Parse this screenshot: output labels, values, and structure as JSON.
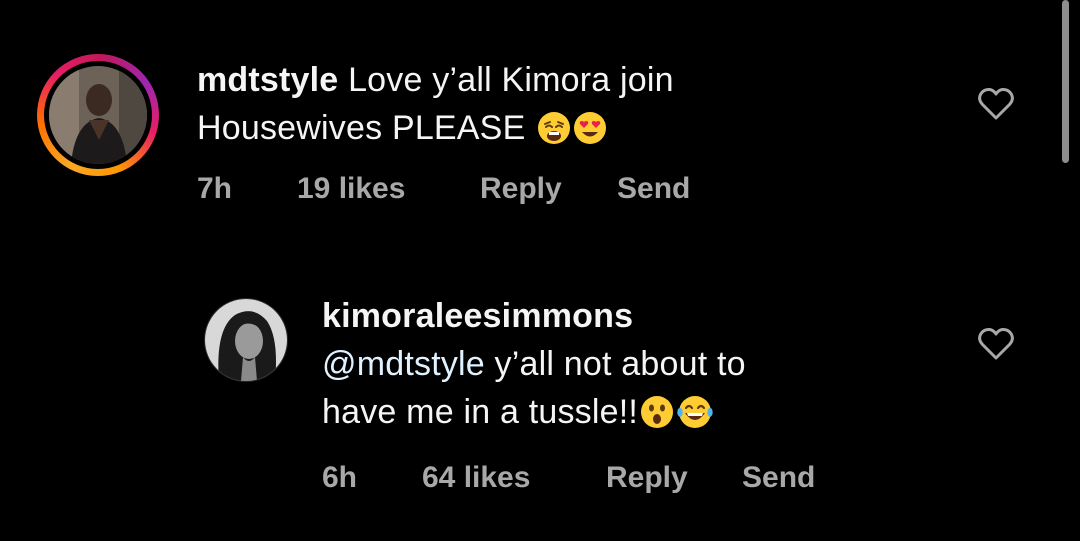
{
  "comments": [
    {
      "username": "mdtstyle",
      "text_line1": "Love y’all Kimora join",
      "text_line2": "Housewives PLEASE",
      "time": "7h",
      "likes": "19 likes",
      "reply": "Reply",
      "send": "Send",
      "emojis": [
        "weary-face-emoji",
        "heart-eyes-emoji"
      ]
    },
    {
      "username": "kimoraleesimmons",
      "mention": "@mdtstyle",
      "text_line1": " y’all not about to",
      "text_line2": "have me in a tussle!!",
      "time": "6h",
      "likes": "64 likes",
      "reply": "Reply",
      "send": "Send",
      "emojis": [
        "astonished-face-emoji",
        "tears-of-joy-emoji"
      ]
    }
  ],
  "colors": {
    "background": "#000000",
    "text": "#f5f5f5",
    "meta": "#a8a8a8",
    "mention": "#e0f1ff",
    "story_ring": "#e91e63"
  },
  "icons": [
    "heart-icon",
    "avatar"
  ]
}
